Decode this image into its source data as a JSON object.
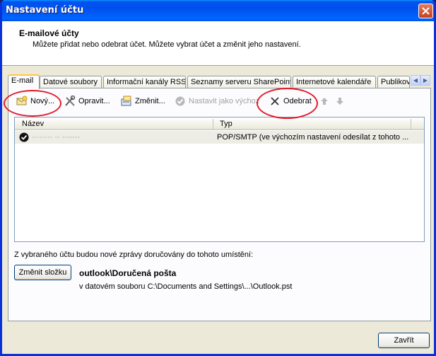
{
  "window": {
    "title": "Nastavení účtu"
  },
  "header": {
    "title": "E-mailové účty",
    "subtitle": "Můžete přidat nebo odebrat účet. Můžete vybrat účet a změnit jeho nastavení."
  },
  "tabs": [
    {
      "label": "E-mail"
    },
    {
      "label": "Datové soubory"
    },
    {
      "label": "Informační kanály RSS"
    },
    {
      "label": "Seznamy serveru SharePoint"
    },
    {
      "label": "Internetové kalendáře"
    },
    {
      "label": "Publikov"
    }
  ],
  "toolbar": {
    "new": "Nový...",
    "repair": "Opravit...",
    "change": "Změnit...",
    "set_default": "Nastavit jako výchoz",
    "remove": "Odebrat"
  },
  "list": {
    "columns": [
      "Název",
      "Typ"
    ],
    "rows": [
      {
        "name": "········ ·· ·······",
        "type": "POP/SMTP (ve výchozím nastavení odesílat z tohoto ..."
      }
    ]
  },
  "delivery": {
    "label": "Z vybraného účtu budou nové zprávy doručovány do tohoto umístění:",
    "change_folder": "Změnit složku",
    "path": "outlook\\Doručená pošta",
    "file": "v datovém souboru C:\\Documents and Settings\\...\\Outlook.pst"
  },
  "footer": {
    "close": "Zavřít"
  },
  "colors": {
    "annotation": "#e21c2a",
    "titlebar": "#0053ee"
  }
}
